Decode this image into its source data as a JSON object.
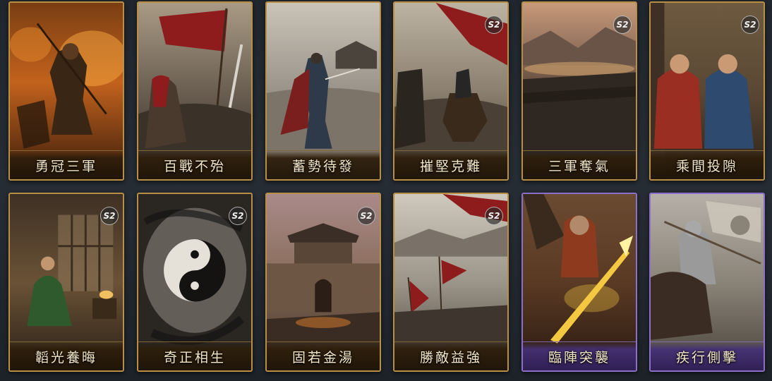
{
  "cards": [
    {
      "name": "勇冠三軍",
      "badge": "",
      "rarity": "gold"
    },
    {
      "name": "百戰不殆",
      "badge": "",
      "rarity": "gold"
    },
    {
      "name": "蓄勢待發",
      "badge": "",
      "rarity": "gold"
    },
    {
      "name": "摧堅克難",
      "badge": "S2",
      "rarity": "gold"
    },
    {
      "name": "三軍奪氣",
      "badge": "S2",
      "rarity": "gold"
    },
    {
      "name": "乘間投隙",
      "badge": "S2",
      "rarity": "gold"
    },
    {
      "name": "韜光養晦",
      "badge": "S2",
      "rarity": "gold"
    },
    {
      "name": "奇正相生",
      "badge": "S2",
      "rarity": "gold"
    },
    {
      "name": "固若金湯",
      "badge": "S2",
      "rarity": "gold"
    },
    {
      "name": "勝敵益強",
      "badge": "S2",
      "rarity": "gold"
    },
    {
      "name": "臨陣突襲",
      "badge": "",
      "rarity": "purple"
    },
    {
      "name": "疾行側擊",
      "badge": "",
      "rarity": "purple"
    }
  ],
  "colors": {
    "gold_frame": "#b98f45",
    "purple_frame": "#8c6fc8",
    "background": "#232930"
  }
}
